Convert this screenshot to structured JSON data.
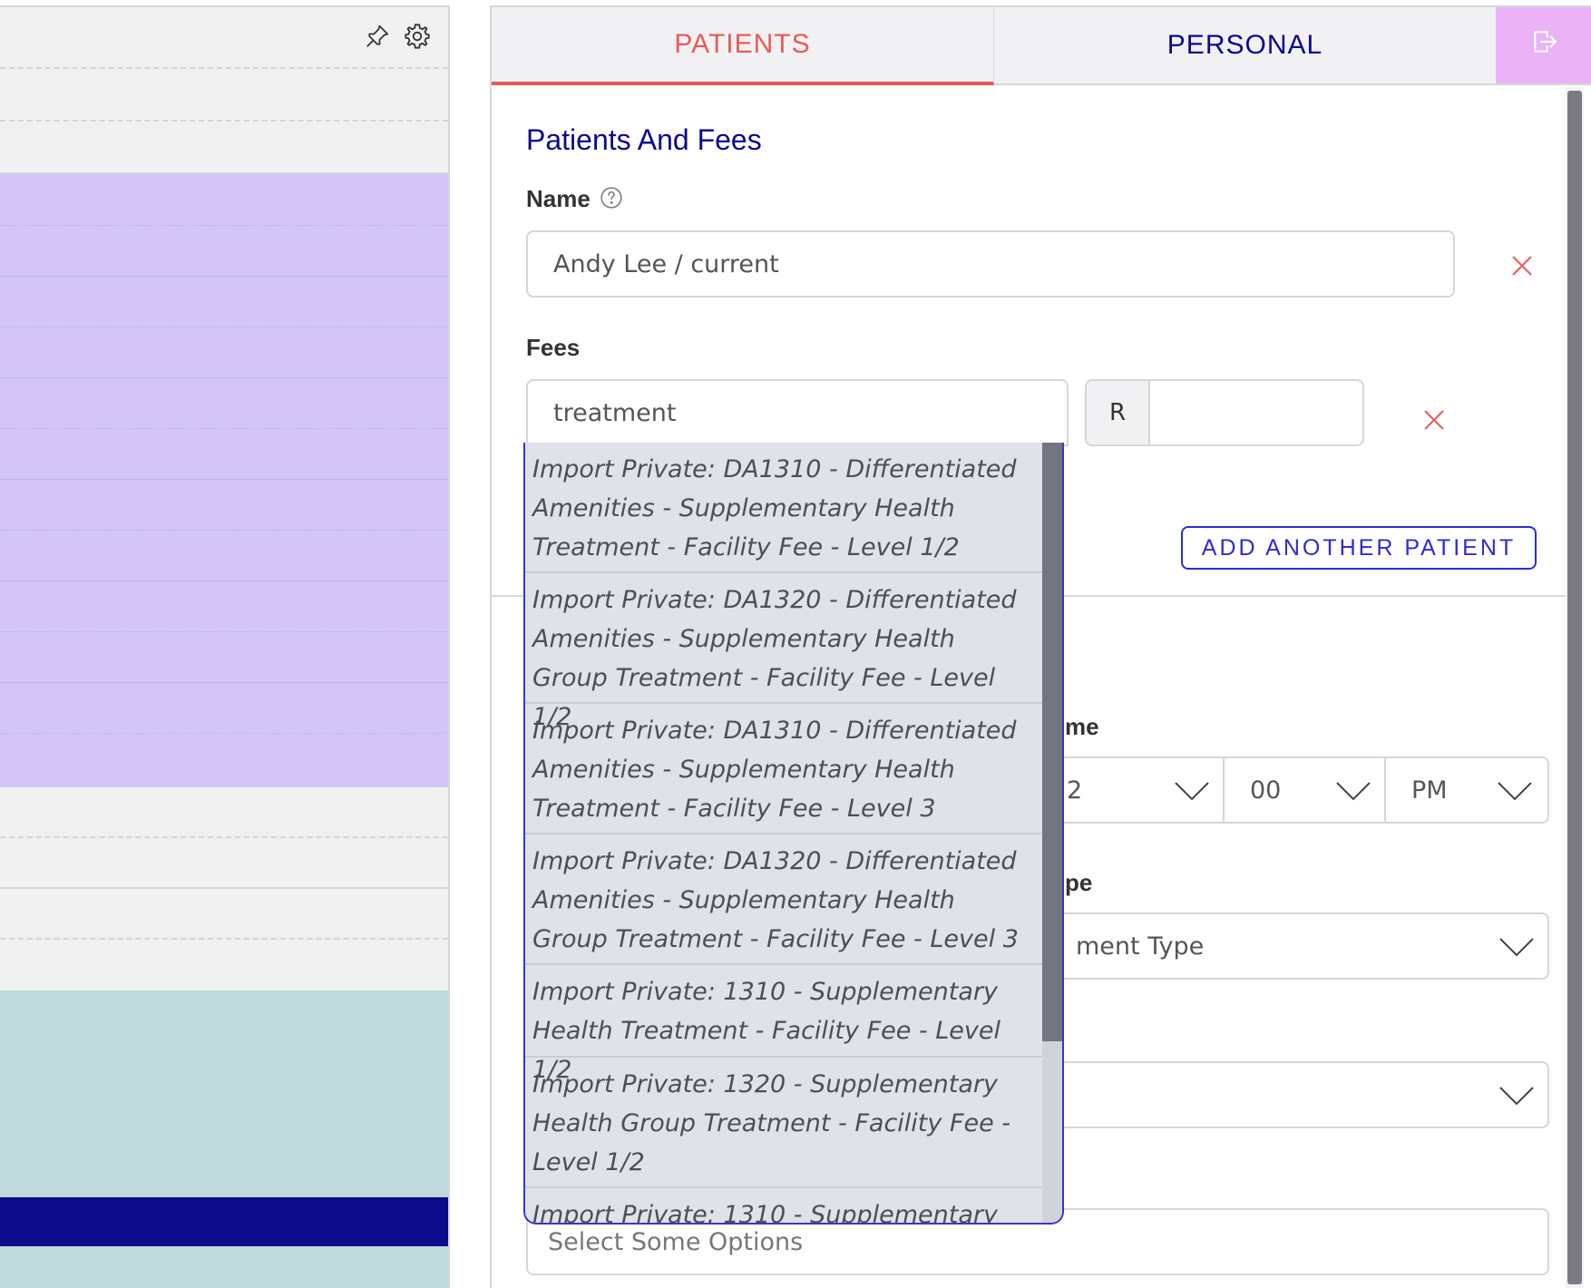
{
  "left_panel": {
    "pin_icon": "pin-icon",
    "settings_icon": "gear-icon",
    "colors": {
      "background": "#f1f1f1",
      "purple_band": "#d3c6f7",
      "teal_band": "#bfd9dd",
      "navy_bar": "#0d0a8c"
    }
  },
  "tabs": [
    {
      "label": "PATIENTS",
      "active": true
    },
    {
      "label": "PERSONAL",
      "active": false
    }
  ],
  "logout_icon": "logout-icon",
  "form": {
    "section_title": "Patients And Fees",
    "name_label": "Name",
    "name_help_icon": "question-circle-icon",
    "name_value": "Andy Lee / current",
    "fees_label": "Fees",
    "fee_search_value": "treatment",
    "currency_symbol": "R",
    "fee_amount_value": "",
    "add_patient_label": "ADD ANOTHER PATIENT",
    "time_label_partial": "me",
    "hour_value_partial": "2",
    "minute_value": "00",
    "meridiem_value": "PM",
    "type_label_partial": "pe",
    "type_value_partial": "ment Type",
    "options_placeholder": "Select Some Options"
  },
  "fee_dropdown": {
    "options": [
      "Import Private: DA1310 - Differentiated Amenities - Supplementary Health Treatment - Facility Fee - Level 1/2",
      "Import Private: DA1320 - Differentiated Amenities - Supplementary Health Group Treatment - Facility Fee - Level 1/2",
      "Import Private: DA1310 - Differentiated Amenities - Supplementary Health Treatment - Facility Fee - Level 3",
      "Import Private: DA1320 - Differentiated Amenities - Supplementary Health Group Treatment - Facility Fee - Level 3",
      "Import Private: 1310 - Supplementary Health Treatment - Facility Fee - Level 1/2",
      "Import Private: 1320 - Supplementary Health Group Treatment - Facility Fee - Level 1/2",
      "Import Private: 1310 - Supplementary"
    ]
  }
}
